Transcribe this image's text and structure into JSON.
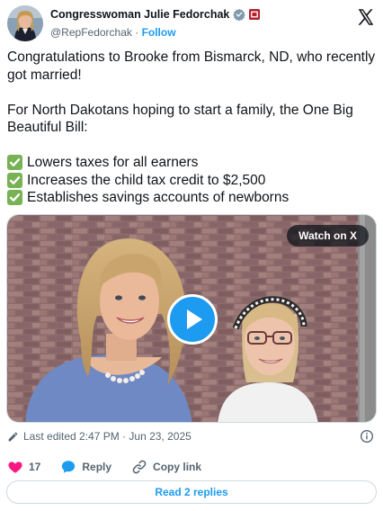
{
  "author": {
    "display_name": "Congresswoman Julie Fedorchak",
    "handle": "@RepFedorchak",
    "separator": " · ",
    "follow_label": "Follow"
  },
  "post": {
    "line1": "Congratulations to Brooke from Bismarck, ND, who recently got married!",
    "line2": "For North Dakotans hoping to start a family, the One Big Beautiful Bill:",
    "bullets": [
      "Lowers taxes for all earners",
      "Increases the child tax credit to $2,500",
      "Establishes savings accounts of newborns"
    ]
  },
  "media": {
    "watch_label": "Watch on X",
    "kind": "video"
  },
  "meta": {
    "edited_text": "Last edited 2:47 PM · Jun 23, 2025"
  },
  "actions": {
    "likes_count": "17",
    "reply_label": "Reply",
    "copy_label": "Copy link"
  },
  "read_replies_label": "Read 2 replies",
  "colors": {
    "accent": "#1d9bf0",
    "like": "#f91880",
    "text": "#0f1419",
    "muted": "#536471",
    "check_green": "#77b255"
  },
  "icons": [
    "verified-badge-icon",
    "flag-icon",
    "x-logo-icon",
    "play-icon",
    "pencil-icon",
    "info-icon",
    "heart-icon",
    "reply-bubble-icon",
    "link-icon",
    "check-icon"
  ]
}
